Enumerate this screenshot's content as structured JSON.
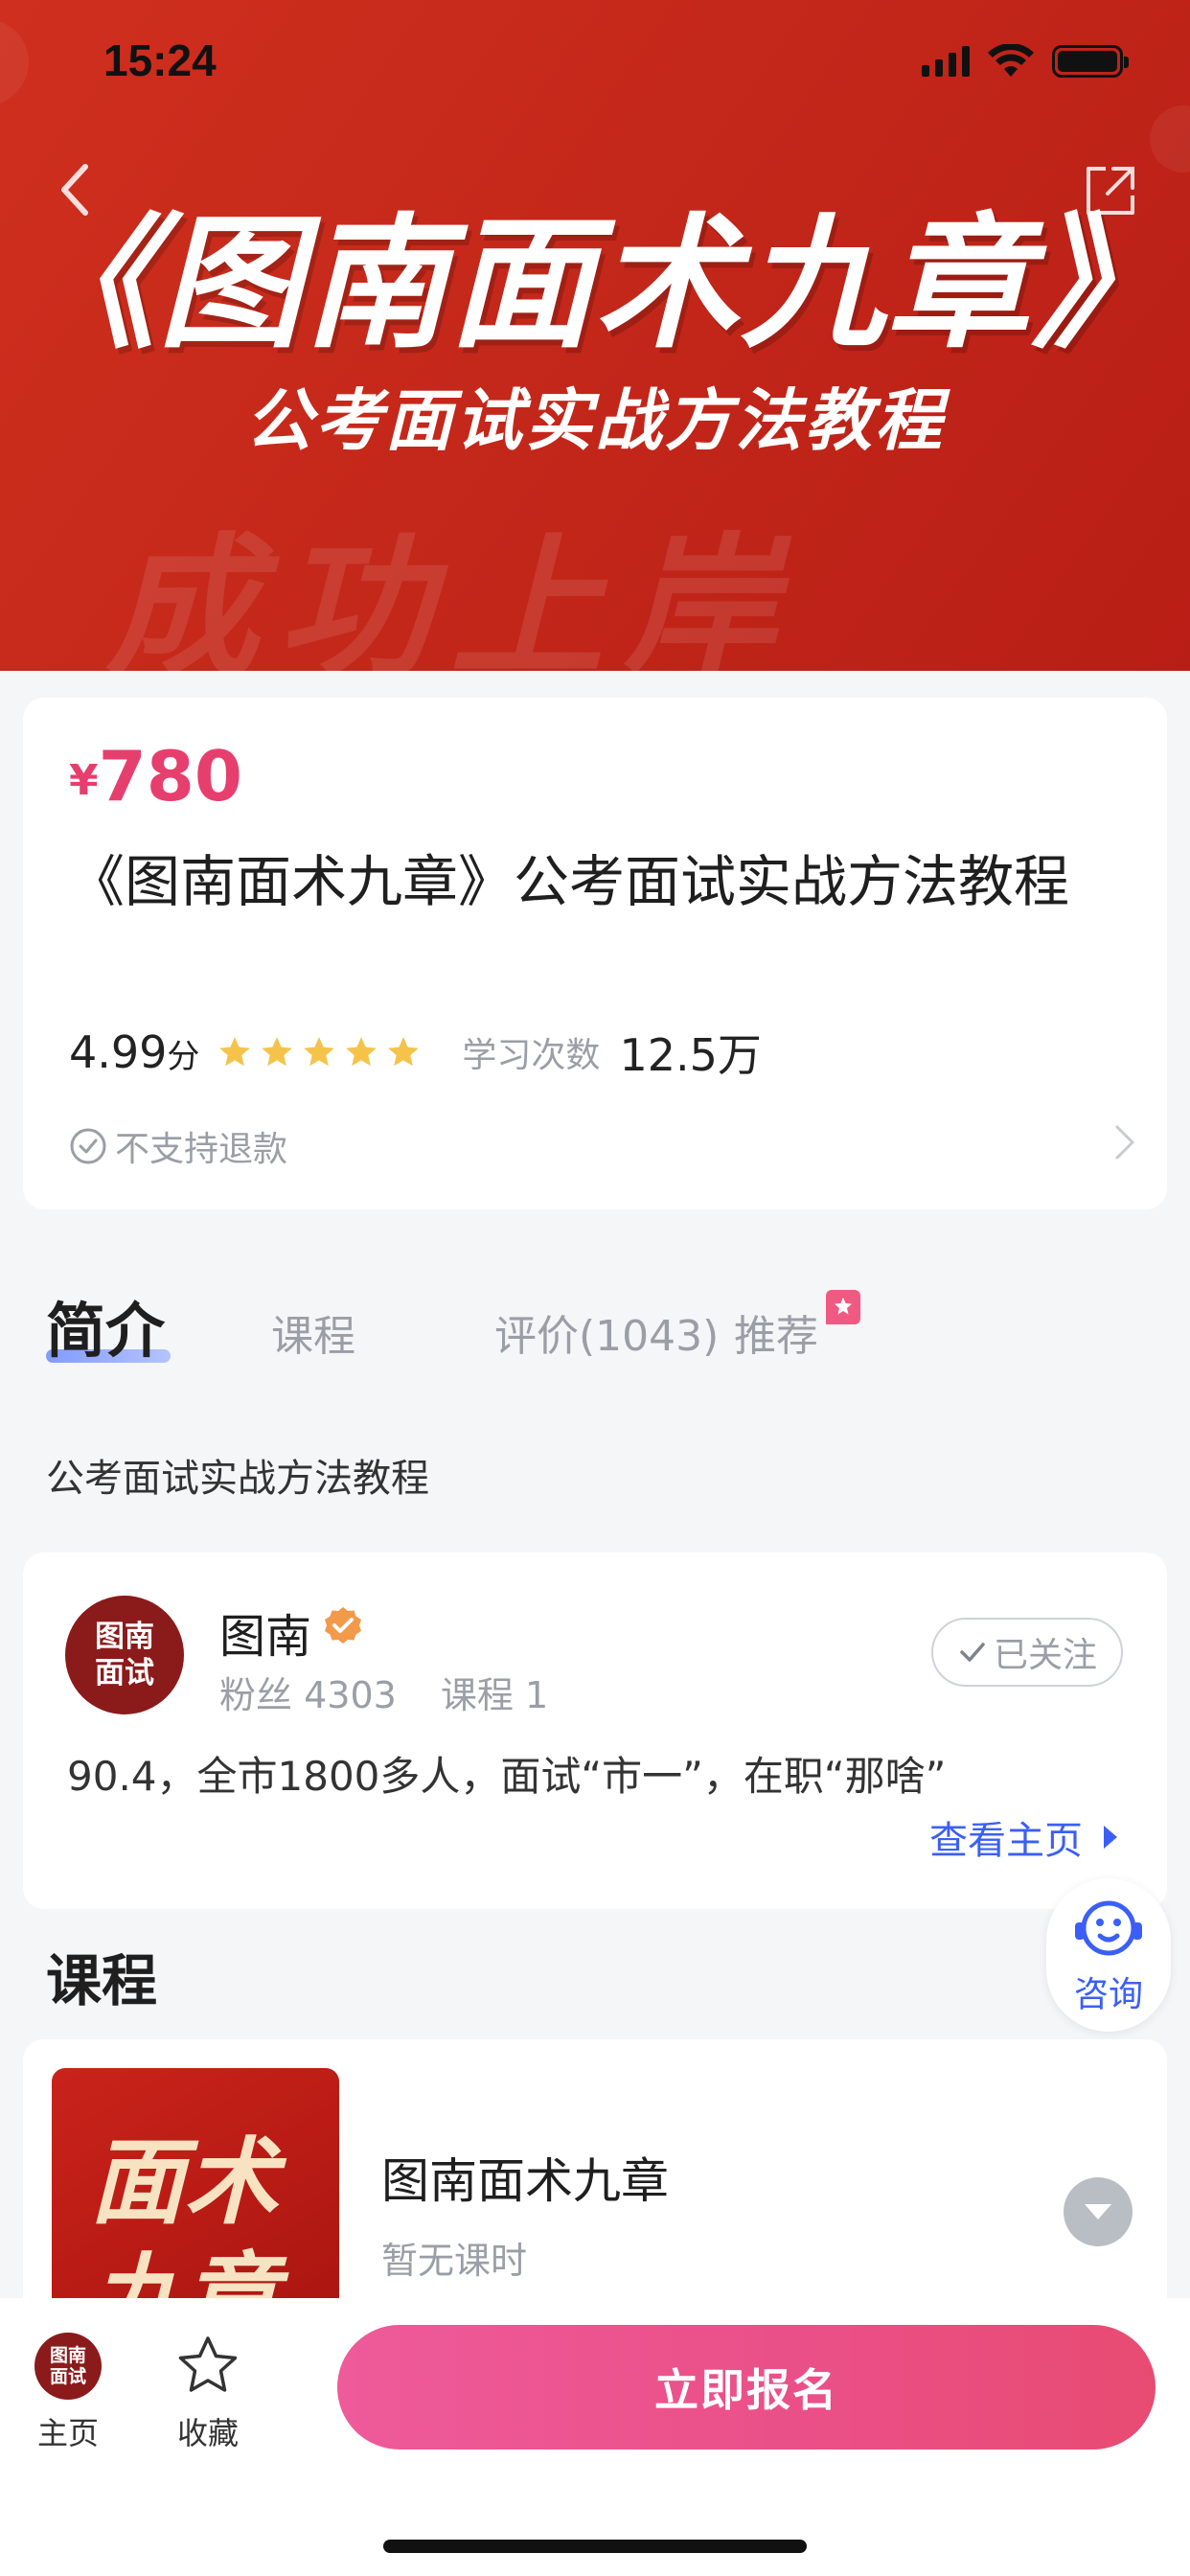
{
  "status_bar": {
    "time": "15:24"
  },
  "hero": {
    "title": "《图南面术九章》",
    "subtitle": "公考面试实战方法教程",
    "watermark": "成功上岸"
  },
  "course": {
    "price_symbol": "¥",
    "price": "780",
    "title": "《图南面术九章》公考面试实战方法教程",
    "score": "4.99",
    "score_unit": "分",
    "rating_stars": 5,
    "study_label": "学习次数",
    "study_count": "12.5万",
    "refund_text": "不支持退款"
  },
  "tabs": {
    "intro": "简介",
    "lessons": "课程",
    "reviews": "评价(1043)",
    "recommend": "推荐"
  },
  "intro": {
    "text": "公考面试实战方法教程"
  },
  "teacher": {
    "avatar_text_line1": "图南",
    "avatar_text_line2": "面试",
    "name": "图南",
    "fans_label": "粉丝",
    "fans_count": "4303",
    "courses_label": "课程",
    "courses_count": "1",
    "follow_label": "已关注",
    "description": "90.4，全市1800多人，面试“市一”，在职“那啥”",
    "homepage_link": "查看主页"
  },
  "consult": {
    "label": "咨询"
  },
  "course_section": {
    "title": "课程",
    "items": [
      {
        "thumb_line1": "面术",
        "thumb_line2": "九章",
        "name": "图南面术九章",
        "subtitle": "暂无课时"
      }
    ]
  },
  "bottom_bar": {
    "home_avatar_line1": "图南",
    "home_avatar_line2": "面试",
    "home_label": "主页",
    "favorite_label": "收藏",
    "enroll_label": "立即报名"
  },
  "colors": {
    "accent_pink": "#e63f6e",
    "link_blue": "#3b5ff6",
    "hero_red": "#c4281a",
    "star_yellow": "#f6c34a",
    "verified_orange": "#f29a4a"
  }
}
